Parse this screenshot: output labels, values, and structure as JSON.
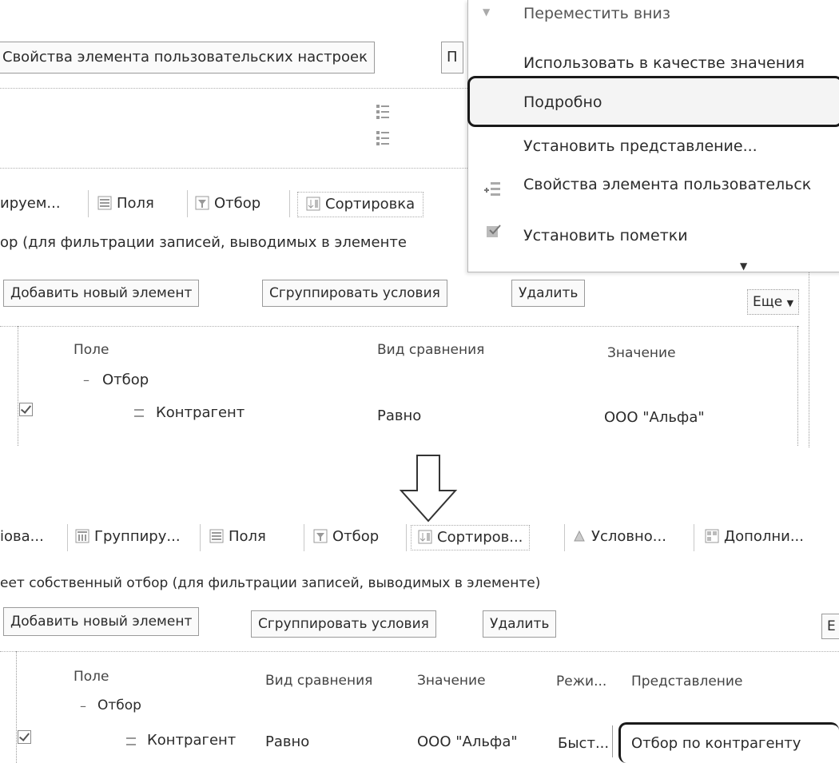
{
  "top": {
    "props_tab": "Свойства элемента пользовательских настроек",
    "cut_tab": "П",
    "tabs": [
      "ируем...",
      "Поля",
      "Отбор",
      "Сортировка"
    ],
    "description": "ор (для фильтрации записей, выводимых в элементе",
    "buttons": {
      "add": "Добавить новый элемент",
      "group": "Сгруппировать условия",
      "delete": "Удалить",
      "more": "Еще"
    },
    "columns": [
      "Поле",
      "Вид сравнения",
      "Значение"
    ],
    "group_row": "Отбор",
    "row": {
      "field": "Контрагент",
      "compare": "Равно",
      "value": "ООО \"Альфа\""
    }
  },
  "menu": {
    "items": [
      "Переместить вниз",
      "Использовать в качестве значения",
      "Подробно",
      "Установить представление...",
      "Свойства элемента пользовательск",
      "Установить пометки"
    ]
  },
  "bottom": {
    "tabs": [
      "іова...",
      "Группиру...",
      "Поля",
      "Отбор",
      "Сортиров...",
      "Условно...",
      "Дополни..."
    ],
    "description": "еет собственный отбор (для фильтрации записей, выводимых в элементе)",
    "buttons": {
      "add": "Добавить новый элемент",
      "group": "Сгруппировать условия",
      "delete": "Удалить",
      "more": "Е"
    },
    "columns": [
      "Поле",
      "Вид сравнения",
      "Значение",
      "Режи...",
      "Представление"
    ],
    "group_row": "Отбор",
    "row": {
      "field": "Контрагент",
      "compare": "Равно",
      "value": "ООО \"Альфа\"",
      "mode": "Быст...",
      "presentation": "Отбор по контрагенту"
    }
  },
  "colors": {
    "highlight_border": "#1a1a1a",
    "separator": "#c8c8c8"
  }
}
